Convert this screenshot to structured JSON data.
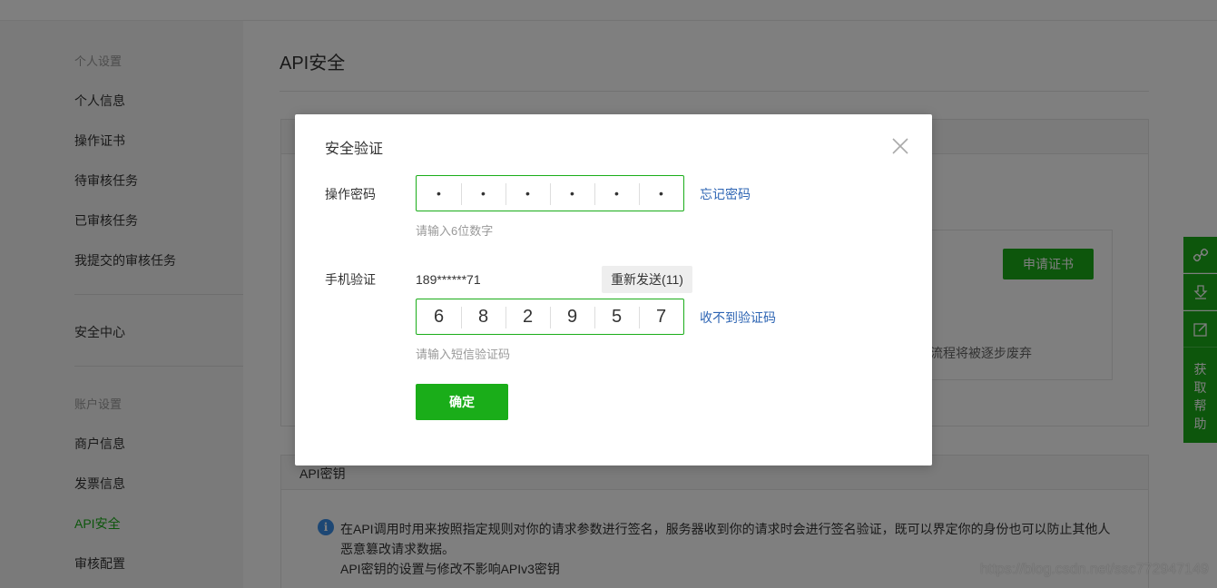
{
  "sidebar": {
    "group1_title": "个人设置",
    "group1_items": [
      "个人信息",
      "操作证书",
      "待审核任务",
      "已审核任务",
      "我提交的审核任务"
    ],
    "security_center": "安全中心",
    "group2_title": "账户设置",
    "group2_items": [
      "商户信息",
      "发票信息",
      "API安全",
      "审核配置"
    ]
  },
  "main": {
    "page_title": "API安全",
    "apply_cert_button": "申请证书",
    "faded_text": "流程将被逐步废弃",
    "api_key_panel_title": "API密钥",
    "info_lines": [
      "在API调用时用来按照指定规则对你的请求参数进行签名，服务器收到你的请求时会进行签名验证，既可以界定你的身份也可以防止其他人",
      "恶意篡改请求数据。",
      "API密钥的设置与修改不影响APIv3密钥"
    ]
  },
  "float_bar": {
    "help_label": "获取帮助",
    "icons": [
      "link-icon",
      "download-icon",
      "edit-icon"
    ]
  },
  "watermark": "https://blog.csdn.net/ssc772947149",
  "modal": {
    "title": "安全验证",
    "password_label": "操作密码",
    "password_digits": [
      "•",
      "•",
      "•",
      "•",
      "•",
      "•"
    ],
    "forgot_password_link": "忘记密码",
    "password_hint": "请输入6位数字",
    "phone_label": "手机验证",
    "phone_number": "189******71",
    "resend_button": "重新发送(11)",
    "sms_digits": [
      "6",
      "8",
      "2",
      "9",
      "5",
      "7"
    ],
    "no_code_link": "收不到验证码",
    "sms_hint": "请输入短信验证码",
    "confirm_button": "确定"
  },
  "colors": {
    "brand_green": "#1aad19",
    "link_blue": "#2d64b3",
    "info_blue": "#3b8ee8"
  }
}
